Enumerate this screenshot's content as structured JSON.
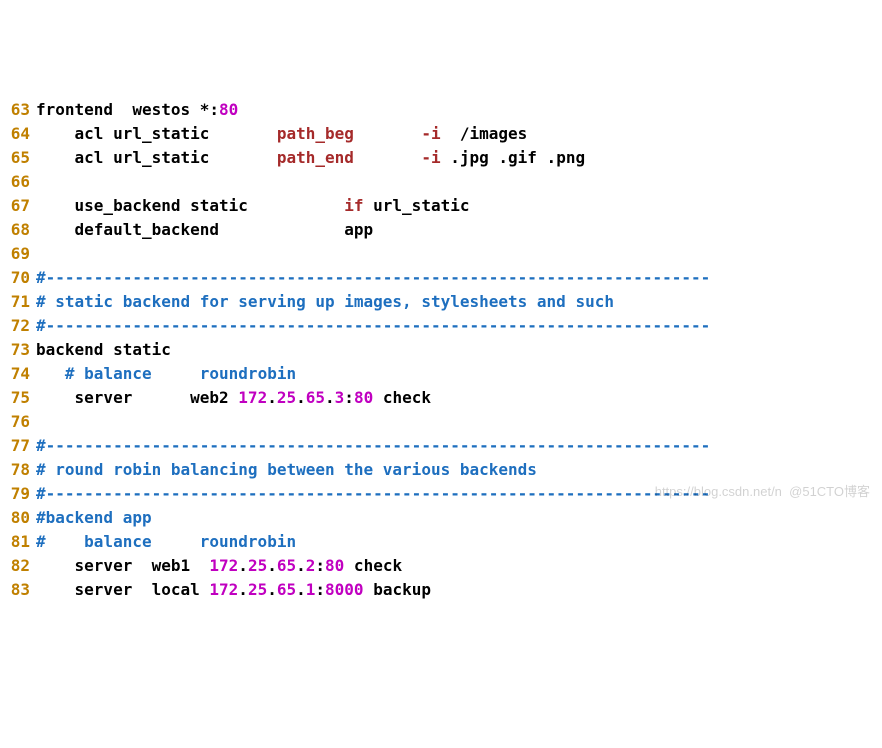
{
  "chart_data": {
    "type": "code-listing",
    "language": "haproxy-cfg",
    "first_line_number": 63,
    "lines": [
      {
        "n": 63,
        "tokens": [
          {
            "t": "frontend  westos *:",
            "c": "txt"
          },
          {
            "t": "80",
            "c": "num"
          }
        ]
      },
      {
        "n": 64,
        "tokens": [
          {
            "t": "    acl url_static       ",
            "c": "txt"
          },
          {
            "t": "path_beg",
            "c": "kw"
          },
          {
            "t": "       ",
            "c": "txt"
          },
          {
            "t": "-i",
            "c": "kw"
          },
          {
            "t": "  /images",
            "c": "txt"
          }
        ]
      },
      {
        "n": 65,
        "tokens": [
          {
            "t": "    acl url_static       ",
            "c": "txt"
          },
          {
            "t": "path_end",
            "c": "kw"
          },
          {
            "t": "       ",
            "c": "txt"
          },
          {
            "t": "-i",
            "c": "kw"
          },
          {
            "t": " .jpg .gif .png",
            "c": "txt"
          }
        ]
      },
      {
        "n": 66,
        "tokens": [
          {
            "t": "",
            "c": "txt"
          }
        ]
      },
      {
        "n": 67,
        "tokens": [
          {
            "t": "    use_backend static          ",
            "c": "txt"
          },
          {
            "t": "if",
            "c": "kw"
          },
          {
            "t": " url_static",
            "c": "txt"
          }
        ]
      },
      {
        "n": 68,
        "tokens": [
          {
            "t": "    default_backend             app",
            "c": "txt"
          }
        ]
      },
      {
        "n": 69,
        "tokens": [
          {
            "t": "",
            "c": "txt"
          }
        ]
      },
      {
        "n": 70,
        "tokens": [
          {
            "t": "#---------------------------------------------------------------------",
            "c": "cmt"
          }
        ]
      },
      {
        "n": 71,
        "tokens": [
          {
            "t": "# static backend for serving up images, stylesheets and such",
            "c": "cmt"
          }
        ]
      },
      {
        "n": 72,
        "tokens": [
          {
            "t": "#---------------------------------------------------------------------",
            "c": "cmt"
          }
        ]
      },
      {
        "n": 73,
        "tokens": [
          {
            "t": "backend static",
            "c": "txt"
          }
        ]
      },
      {
        "n": 74,
        "tokens": [
          {
            "t": "   ",
            "c": "txt"
          },
          {
            "t": "# balance     roundrobin",
            "c": "cmt"
          }
        ]
      },
      {
        "n": 75,
        "tokens": [
          {
            "t": "    server      web2 ",
            "c": "txt"
          },
          {
            "t": "172",
            "c": "num"
          },
          {
            "t": ".",
            "c": "txt"
          },
          {
            "t": "25",
            "c": "num"
          },
          {
            "t": ".",
            "c": "txt"
          },
          {
            "t": "65",
            "c": "num"
          },
          {
            "t": ".",
            "c": "txt"
          },
          {
            "t": "3",
            "c": "num"
          },
          {
            "t": ":",
            "c": "txt"
          },
          {
            "t": "80",
            "c": "num"
          },
          {
            "t": " check",
            "c": "txt"
          }
        ]
      },
      {
        "n": 76,
        "tokens": [
          {
            "t": "",
            "c": "txt"
          }
        ]
      },
      {
        "n": 77,
        "tokens": [
          {
            "t": "#---------------------------------------------------------------------",
            "c": "cmt"
          }
        ]
      },
      {
        "n": 78,
        "tokens": [
          {
            "t": "# round robin balancing between the various backends",
            "c": "cmt"
          }
        ]
      },
      {
        "n": 79,
        "tokens": [
          {
            "t": "#---------------------------------------------------------------------",
            "c": "cmt"
          }
        ]
      },
      {
        "n": 80,
        "tokens": [
          {
            "t": "#backend app",
            "c": "cmt"
          }
        ]
      },
      {
        "n": 81,
        "tokens": [
          {
            "t": "#    balance     roundrobin",
            "c": "cmt"
          }
        ]
      },
      {
        "n": 82,
        "tokens": [
          {
            "t": "    server  web1  ",
            "c": "txt"
          },
          {
            "t": "172",
            "c": "num"
          },
          {
            "t": ".",
            "c": "txt"
          },
          {
            "t": "25",
            "c": "num"
          },
          {
            "t": ".",
            "c": "txt"
          },
          {
            "t": "65",
            "c": "num"
          },
          {
            "t": ".",
            "c": "txt"
          },
          {
            "t": "2",
            "c": "num"
          },
          {
            "t": ":",
            "c": "txt"
          },
          {
            "t": "80",
            "c": "num"
          },
          {
            "t": " check",
            "c": "txt"
          }
        ]
      },
      {
        "n": 83,
        "tokens": [
          {
            "t": "    server  local ",
            "c": "txt"
          },
          {
            "t": "172",
            "c": "num"
          },
          {
            "t": ".",
            "c": "txt"
          },
          {
            "t": "25",
            "c": "num"
          },
          {
            "t": ".",
            "c": "txt"
          },
          {
            "t": "65",
            "c": "num"
          },
          {
            "t": ".",
            "c": "txt"
          },
          {
            "t": "1",
            "c": "num"
          },
          {
            "t": ":",
            "c": "txt"
          },
          {
            "t": "8000",
            "c": "num"
          },
          {
            "t": " backup",
            "c": "txt"
          }
        ]
      }
    ]
  },
  "watermark": "https://blog.csdn.net/n  @51CTO博客"
}
